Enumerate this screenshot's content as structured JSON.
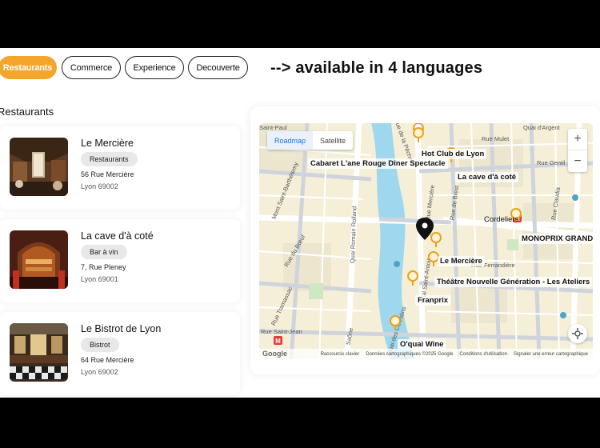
{
  "filters": [
    {
      "label": "Restaurants",
      "active": true
    },
    {
      "label": "Commerce",
      "active": false
    },
    {
      "label": "Experience",
      "active": false
    },
    {
      "label": "Decouverte",
      "active": false
    }
  ],
  "tagline": "--> available in 4 languages",
  "section_title": "Restaurants",
  "places": [
    {
      "name": "Le Mercière",
      "category": "Restaurants",
      "address": "56 Rue Mercière",
      "city": "Lyon 69002"
    },
    {
      "name": "La cave d'à coté",
      "category": "Bar à vin",
      "address": "7, Rue Pleney",
      "city": "Lyon 69001"
    },
    {
      "name": "Le Bistrot de Lyon",
      "category": "Bistrot",
      "address": "64 Rue Mercière",
      "city": "Lyon 69002"
    }
  ],
  "map": {
    "toggle": {
      "roadmap": "Roadmap",
      "satellite": "Satellite"
    },
    "zoom_in": "+",
    "zoom_out": "−",
    "poi": [
      "Hot Club de Lyon",
      "Cabaret L'ane Rouge Dîner Spectacle",
      "La cave d'à coté",
      "Cordeliers",
      "MONOPRIX GRAND",
      "Le Mercière",
      "Théâtre Nouvelle Génération - Les Ateliers",
      "Franprix",
      "O'quai Wine"
    ],
    "streets": [
      "Saint-Paul",
      "Mont Saint-Barthélemy",
      "Quai Romain Rolland",
      "Rue du Bœuf",
      "Rue Tramassac",
      "Quai Saint-Antoine",
      "Rue Mercière",
      "Rue de Brest",
      "Rue Mulet",
      "Rue Gentil",
      "Rue Claudia",
      "Rue Ferrandière",
      "Saône",
      "Rue Saint-Jean",
      "Rue de la Pêcherie",
      "Quai des Célestins",
      "Quai d'Argent"
    ],
    "footer": [
      "Raccourcis clavier",
      "Données cartographiques ©2025 Google",
      "Conditions d'utilisation",
      "Signaler une erreur cartographique"
    ],
    "logo": "Google",
    "metro_icon": "M"
  },
  "colors": {
    "accent": "#f4a62a",
    "river": "#9fd8ee",
    "marker": "#e8a21b"
  }
}
